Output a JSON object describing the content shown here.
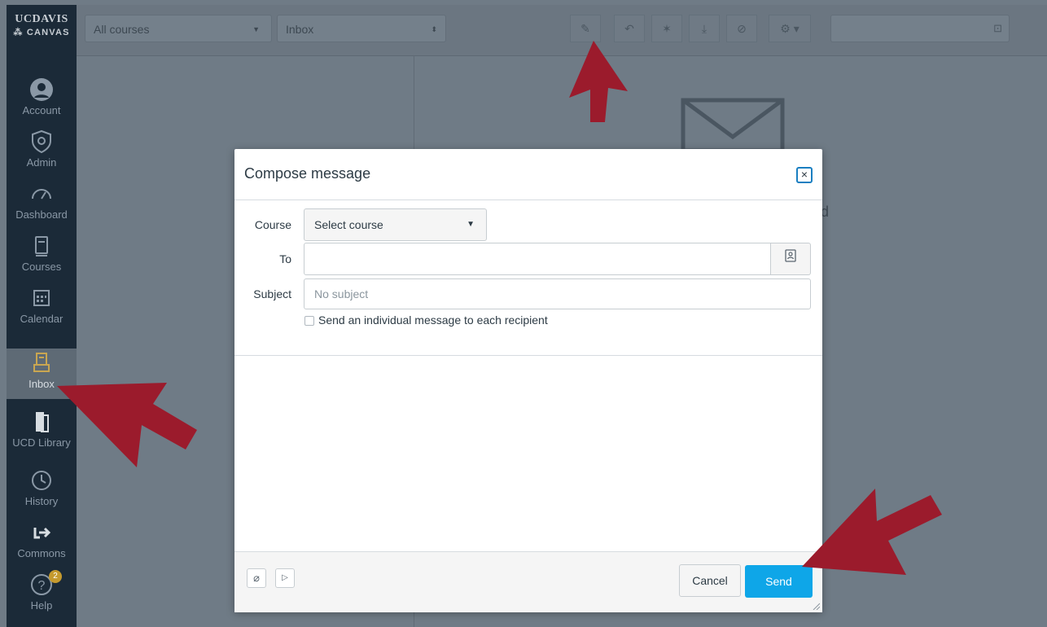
{
  "logo": {
    "line1": "UCDAVIS",
    "line2": "CANVAS"
  },
  "nav": [
    {
      "label": "Account",
      "icon": "account-icon"
    },
    {
      "label": "Admin",
      "icon": "admin-icon"
    },
    {
      "label": "Dashboard",
      "icon": "dashboard-icon"
    },
    {
      "label": "Courses",
      "icon": "courses-icon"
    },
    {
      "label": "Calendar",
      "icon": "calendar-icon"
    },
    {
      "label": "Inbox",
      "icon": "inbox-icon"
    },
    {
      "label": "UCD Library",
      "icon": "library-icon"
    },
    {
      "label": "History",
      "icon": "history-icon"
    },
    {
      "label": "Commons",
      "icon": "commons-icon"
    },
    {
      "label": "Help",
      "icon": "help-icon",
      "badge": "2"
    }
  ],
  "toolbar": {
    "course_filter": "All courses",
    "mailbox": "Inbox"
  },
  "modal": {
    "title": "Compose message",
    "course_label": "Course",
    "course_value": "Select course",
    "to_label": "To",
    "subject_label": "Subject",
    "subject_placeholder": "No subject",
    "individual_label": "Send an individual message to each recipient",
    "cancel": "Cancel",
    "send": "Send"
  },
  "colors": {
    "send_button": "#0ea6e8",
    "nav_bg": "#1b2a38",
    "arrow": "#9b1b2c"
  }
}
